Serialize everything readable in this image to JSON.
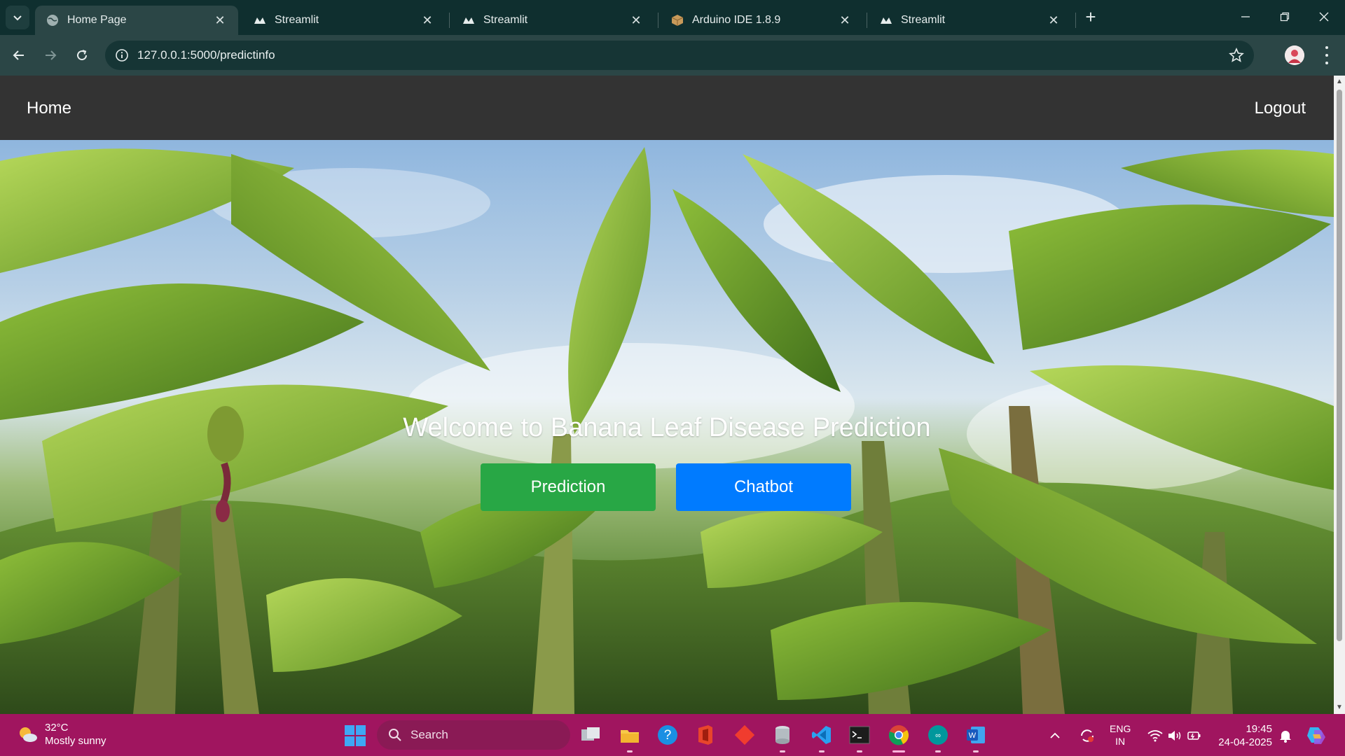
{
  "browser": {
    "tabs": [
      {
        "label": "Home Page",
        "icon": "globe-icon",
        "active": true
      },
      {
        "label": "Streamlit",
        "icon": "streamlit-icon",
        "active": false
      },
      {
        "label": "Streamlit",
        "icon": "streamlit-icon",
        "active": false
      },
      {
        "label": "Arduino IDE 1.8.9",
        "icon": "package-icon",
        "active": false
      },
      {
        "label": "Streamlit",
        "icon": "streamlit-icon",
        "active": false
      }
    ],
    "new_tab": "+",
    "close_glyph": "✕",
    "url": "127.0.0.1:5000/predictinfo"
  },
  "page": {
    "nav": {
      "home": "Home",
      "logout": "Logout"
    },
    "hero": {
      "title": "Welcome to Banana Leaf Disease Prediction",
      "prediction_button": "Prediction",
      "chatbot_button": "Chatbot"
    },
    "colors": {
      "navbar": "#333333",
      "prediction": "#28a745",
      "chatbot": "#007bff"
    }
  },
  "taskbar": {
    "weather": {
      "temp": "32°C",
      "condition": "Mostly sunny"
    },
    "search_placeholder": "Search",
    "apps": [
      "task-view-icon",
      "file-explorer-icon",
      "help-icon",
      "office-icon",
      "git-icon",
      "database-icon",
      "vscode-icon",
      "terminal-icon",
      "chrome-icon",
      "arduino-icon",
      "word-icon"
    ],
    "language": {
      "line1": "ENG",
      "line2": "IN"
    },
    "clock": {
      "time": "19:45",
      "date": "24-04-2025"
    },
    "color": "#a0155f"
  }
}
